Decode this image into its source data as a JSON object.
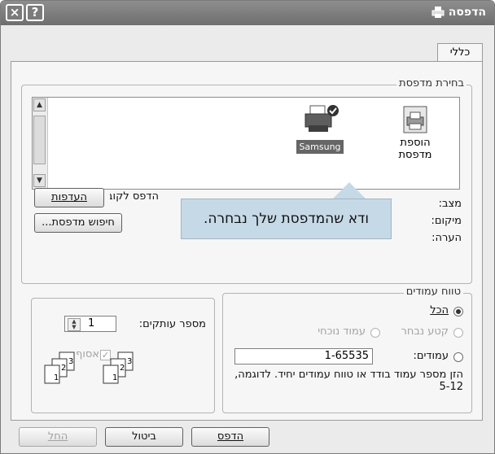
{
  "window": {
    "title": "הדפסה",
    "help_label": "?",
    "close_label": "×"
  },
  "tabs": [
    {
      "label": "כללי"
    }
  ],
  "printer_select": {
    "legend": "בחירת מדפסת",
    "add_printer_label": "הוספת מדפסת",
    "samsung_label": "Samsung",
    "status_label": "מצב:",
    "location_label": "מיקום:",
    "comment_label": "הערה:",
    "print_to_file_label": "הדפס לקובץ",
    "preferences_button": "העדפות",
    "find_printer_button": "חיפוש מדפסת..."
  },
  "callout": {
    "text": "ודא שהמדפסת שלך נבחרה."
  },
  "page_range": {
    "legend": "טווח עמודים",
    "all_label": "הכל",
    "selection_label": "קטע נבחר",
    "current_page_label": "עמוד נוכחי",
    "pages_label": "עמודים:",
    "pages_value": "1-65535",
    "hint_text": "הזן מספר עמוד בודד או טווח עמודים יחיד. לדוגמה, 5-12"
  },
  "copies": {
    "label": "מספר עותקים:",
    "value": "1",
    "collate_label": "אסוף"
  },
  "footer": {
    "print_button": "הדפס",
    "cancel_button": "ביטול",
    "apply_button": "החל"
  }
}
